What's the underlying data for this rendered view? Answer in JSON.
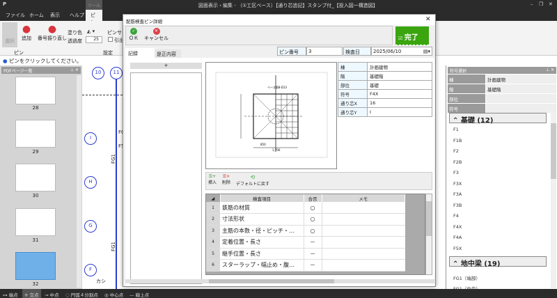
{
  "window": {
    "title": "図面表示・編集 - （①工区ベース）【通り芯追記】スタンプ付_【投入図ー構造図】",
    "controls": [
      "–",
      "❐",
      "✕"
    ]
  },
  "ribbon": {
    "tabs": [
      "ファイル",
      "ホーム",
      "表示",
      "ヘルプ",
      "ピン"
    ],
    "context_tab": "ツール",
    "buttons": {
      "select": "選択",
      "add": "追加",
      "renumber": "番号振り直し"
    },
    "group_pin": "ピン",
    "group_settings": "設定",
    "fill_color_label": "塗り色",
    "opacity_label": "透過度",
    "opacity_value": "25",
    "pin_size_label": "ピンサイズ",
    "leader_label": "引出"
  },
  "hint": "ピンをクリックしてください。",
  "pdf_panel": {
    "title": "PDFページ一覧",
    "pages": [
      "28",
      "29",
      "30",
      "31",
      "32"
    ]
  },
  "canvas": {
    "bubbles": [
      "10",
      "11",
      "I",
      "H",
      "G",
      "F"
    ],
    "labels": [
      "FG1",
      "FG1",
      "FC",
      "F5",
      "カシ"
    ]
  },
  "dialog": {
    "title": "配筋検査ピン詳細",
    "ok": "ＯＫ",
    "cancel": "キャンセル",
    "complete": "完了",
    "tabs": [
      "記録",
      "是正内容"
    ],
    "pin_no_label": "ピン番号",
    "pin_no": "3",
    "date_label": "検査日",
    "date": "2025/06/10",
    "add_label": "+",
    "info": [
      {
        "k": "棟",
        "v": "計画建物"
      },
      {
        "k": "階",
        "v": "基礎階"
      },
      {
        "k": "部位",
        "v": "基礎"
      },
      {
        "k": "符号",
        "v": "F4X"
      },
      {
        "k": "通り芯X",
        "v": "16"
      },
      {
        "k": "通り芯Y",
        "v": "I"
      }
    ],
    "drawing_labels": {
      "top": "ベース筋8-D13",
      "side": "ベース筋8-D13",
      "dim": "1,700",
      "half": "850"
    },
    "toolbar2": {
      "insert": "挿入",
      "delete": "削除",
      "reset": "デフォルトに戻す"
    },
    "grid": {
      "headers": [
        "検査項目",
        "合否",
        "メモ"
      ],
      "rows": [
        {
          "no": "1",
          "item": "鉄筋の材質",
          "result": "○",
          "memo": ""
        },
        {
          "no": "2",
          "item": "寸法形状",
          "result": "○",
          "memo": ""
        },
        {
          "no": "3",
          "item": "主筋の本数・径・ピッチ・…",
          "result": "○",
          "memo": ""
        },
        {
          "no": "4",
          "item": "定着位置・長さ",
          "result": "－",
          "memo": ""
        },
        {
          "no": "5",
          "item": "継手位置・長さ",
          "result": "－",
          "memo": ""
        },
        {
          "no": "6",
          "item": "スターラップ・幅止め・腹…",
          "result": "－",
          "memo": ""
        }
      ]
    }
  },
  "symbol_panel": {
    "title": "符号選択",
    "filters": [
      {
        "k": "棟",
        "v": "計画建物"
      },
      {
        "k": "階",
        "v": "基礎階"
      },
      {
        "k": "部位",
        "v": ""
      },
      {
        "k": "符号",
        "v": ""
      }
    ],
    "groups": [
      {
        "name": "基礎 (12)",
        "items": [
          "F1",
          "F1B",
          "F2",
          "F2B",
          "F3",
          "F3X",
          "F3A",
          "F3B",
          "F4",
          "F4X",
          "F4A",
          "F5X"
        ]
      },
      {
        "name": "地中梁 (19)",
        "items": [
          "FG1（端部）",
          "FG1（中央）"
        ]
      }
    ]
  },
  "status": [
    "端点",
    "交点",
    "中点",
    "円弧４分割点",
    "中心点",
    "線上点"
  ],
  "colors": {
    "complete": "#3aa50f",
    "ok": "#3aa53a",
    "cancel": "#d9434a",
    "pin": "#d9343c",
    "bubble": "#2a3ad0",
    "selected_page": "#6fb0e8"
  }
}
